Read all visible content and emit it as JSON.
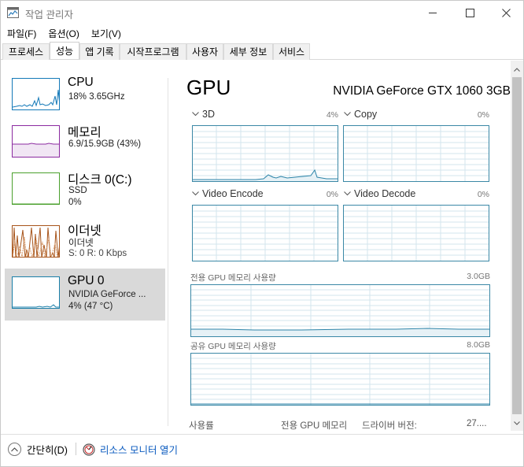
{
  "window": {
    "title": "작업 관리자"
  },
  "menu": [
    "파일(F)",
    "옵션(O)",
    "보기(V)"
  ],
  "tabs": [
    "프로세스",
    "성능",
    "앱 기록",
    "시작프로그램",
    "사용자",
    "세부 정보",
    "서비스"
  ],
  "active_tab": "성능",
  "sidebar": {
    "items": [
      {
        "title": "CPU",
        "sub1": "18% 3.65GHz",
        "sub2": "",
        "color": "#1479b8"
      },
      {
        "title": "메모리",
        "sub1": "6.9/15.9GB (43%)",
        "sub2": "",
        "color": "#8b2aa0"
      },
      {
        "title": "디스크 0(C:)",
        "sub1": "SSD",
        "sub2": "0%",
        "color": "#4aa02c"
      },
      {
        "title": "이더넷",
        "sub1": "이더넷",
        "sub2": "S: 0 R: 0 Kbps",
        "color": "#a7541a"
      },
      {
        "title": "GPU 0",
        "sub1": "NVIDIA GeForce ...",
        "sub2": "4% (47 °C)",
        "color": "#1a7ea8"
      }
    ],
    "selected": "GPU 0"
  },
  "main": {
    "title": "GPU",
    "gpu_name": "NVIDIA GeForce GTX 1060 3GB",
    "engines": [
      {
        "name": "3D",
        "percent": "4%"
      },
      {
        "name": "Copy",
        "percent": "0%"
      },
      {
        "name": "Video Encode",
        "percent": "0%"
      },
      {
        "name": "Video Decode",
        "percent": "0%"
      }
    ],
    "dedicated_memory": {
      "label": "전용 GPU 메모리 사용량",
      "value": "3.0GB"
    },
    "shared_memory": {
      "label": "공유 GPU 메모리 사용량",
      "value": "8.0GB"
    },
    "stats": {
      "utilization": "사용률",
      "dedicated": "전용 GPU 메모리",
      "driver_version": "드라이버 버전:",
      "driver_value": "27...."
    }
  },
  "bottom": {
    "fewer_details": "간단히(D)",
    "resource_monitor": "리소스 모니터 열기"
  },
  "colors": {
    "graph_border": "#3b88a6",
    "grid": "#d3e6ee",
    "link": "#0b5bbf",
    "selected_bg": "#d9d9d9"
  }
}
